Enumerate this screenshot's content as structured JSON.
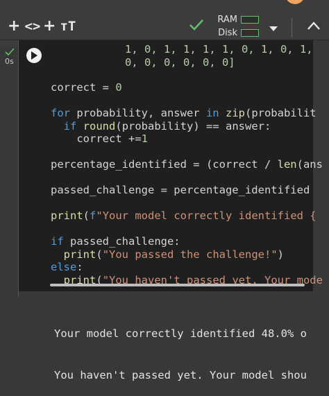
{
  "toolbar": {
    "add_code_plus": "+",
    "add_code_glyph": "<>",
    "add_text_plus": "+",
    "add_text_glyph": "тТ",
    "resources": {
      "ram_label": "RAM",
      "disk_label": "Disk",
      "status_color": "#5fbf6a"
    }
  },
  "cell": {
    "status": "✓",
    "exec_time": "0s",
    "code_lines": [
      "1, 0, 1, 1, 1, 1, 0, 1, 0, 1,",
      "0, 0, 0, 0, 0, 0]",
      "correct = 0",
      "for probability, answer in zip(probabilit",
      "  if round(probability) == answer:",
      "    correct +=1",
      "percentage_identified = (correct / len(ans",
      "passed_challenge = percentage_identified ",
      "print(f\"Your model correctly identified {",
      "if passed_challenge:",
      "  print(\"You passed the challenge!\")",
      "else:",
      "  print(\"You haven't passed yet. Your mode"
    ]
  },
  "output": {
    "lines": [
      "Your model correctly identified 48.0% o",
      "You haven't passed yet. Your model shou"
    ]
  },
  "colors": {
    "keyword": "#569cd6",
    "function": "#dcdcaa",
    "number": "#b5cea8",
    "string": "#ce9178",
    "editor_bg": "#1f1f1f",
    "page_bg": "#383838"
  }
}
